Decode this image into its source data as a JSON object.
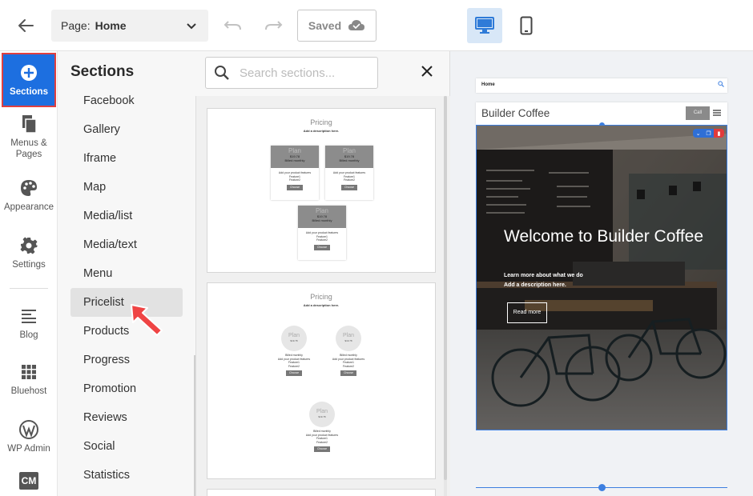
{
  "topbar": {
    "page_label": "Page:",
    "page_value": "Home",
    "saved_label": "Saved"
  },
  "rail": {
    "items": [
      {
        "label": "Sections"
      },
      {
        "label": "Menus & Pages"
      },
      {
        "label": "Appearance"
      },
      {
        "label": "Settings"
      },
      {
        "label": "Blog"
      },
      {
        "label": "Bluehost"
      },
      {
        "label": "WP Admin"
      },
      {
        "label": "CM"
      }
    ]
  },
  "panel": {
    "title": "Sections",
    "search_placeholder": "Search sections...",
    "categories": [
      "Facebook",
      "Gallery",
      "Iframe",
      "Map",
      "Media/list",
      "Media/text",
      "Menu",
      "Pricelist",
      "Products",
      "Progress",
      "Promotion",
      "Reviews",
      "Social",
      "Statistics"
    ],
    "selected_category": "Pricelist"
  },
  "thumbs": {
    "t1": {
      "title": "Pricing",
      "subtitle": "Add a description here.",
      "plan": "Plan",
      "price": "$19.78",
      "billed": "Billed monthly",
      "features": "Add your product features",
      "f1": "Feature1",
      "f2": "Feature2",
      "button": "Choose"
    },
    "t2": {
      "title": "Pricing",
      "subtitle": "Add a description here.",
      "plan": "Plan",
      "price": "$19.78",
      "billed": "Billed monthly",
      "features": "Add your product features",
      "f1": "Feature1",
      "f2": "Feature2",
      "button": "Choose"
    }
  },
  "preview": {
    "nav_home": "Home",
    "brand": "Builder Coffee",
    "call_btn": "Call",
    "hero_title": "Welcome to Builder Coffee",
    "hero_sub_1": "Learn more about what we do",
    "hero_sub_2": "Add a description here.",
    "hero_button": "Read more"
  },
  "colors": {
    "accent": "#1d6fe0",
    "highlight_border": "#e04040",
    "pointer_arrow": "#ef4444"
  }
}
